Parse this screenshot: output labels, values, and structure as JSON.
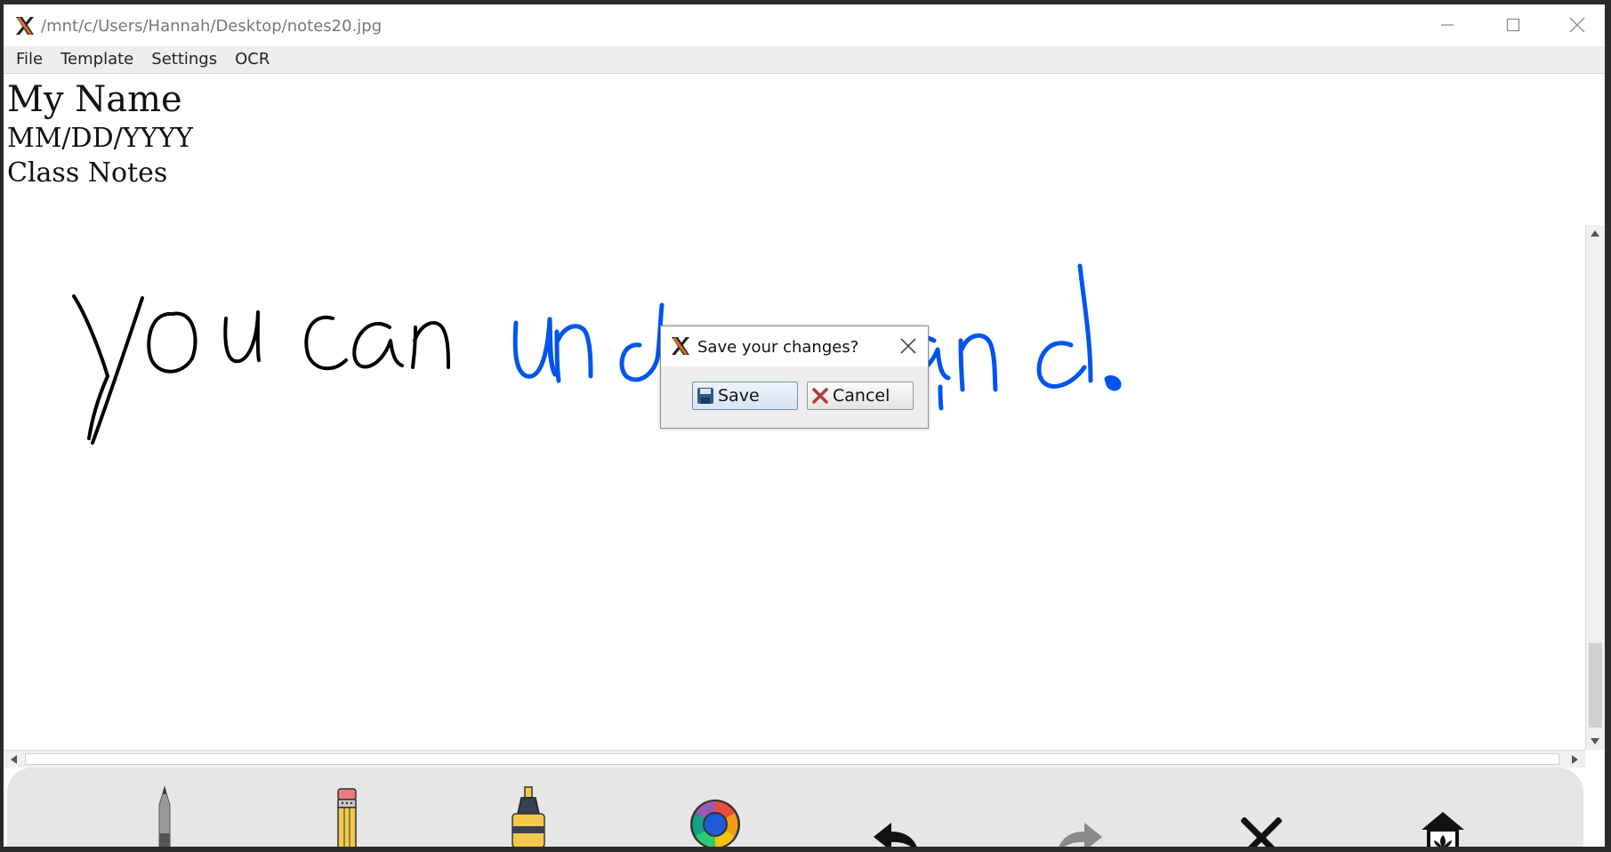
{
  "window": {
    "title": "/mnt/c/Users/Hannah/Desktop/notes20.jpg"
  },
  "menu": {
    "items": [
      "File",
      "Template",
      "Settings",
      "OCR"
    ]
  },
  "template_header": {
    "name": "My Name",
    "date": "MM/DD/YYYY",
    "class": "Class Notes"
  },
  "ink": {
    "black_color": "#000000",
    "blue_color": "#0055ee"
  },
  "dialog": {
    "title": "Save your changes?",
    "save_label": "Save",
    "cancel_label": "Cancel"
  },
  "toolbar": {
    "tools": [
      "pen-icon",
      "pencil-icon",
      "highlighter-icon",
      "color-wheel-icon",
      "undo-icon",
      "redo-icon",
      "clear-icon",
      "home-icon"
    ]
  }
}
